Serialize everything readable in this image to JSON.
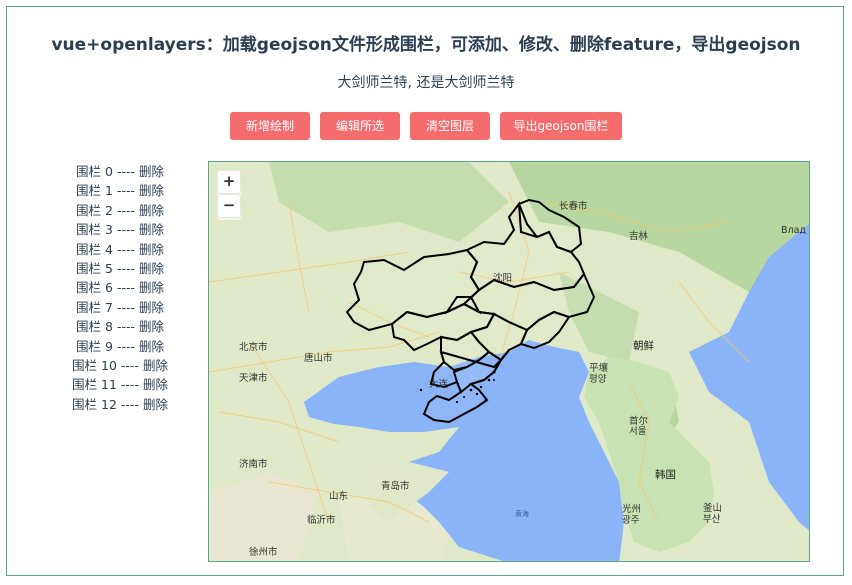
{
  "title": "vue+openlayers：加载geojson文件形成围栏，可添加、修改、删除feature，导出geojson",
  "subtitle": "大剑师兰特, 还是大剑师兰特",
  "buttons": {
    "add": "新增绘制",
    "edit": "编辑所选",
    "clear": "清空图层",
    "export": "导出geojson围栏"
  },
  "accent_color": "#f56c6c",
  "fences": [
    {
      "name": "围栏 0",
      "sep": "----",
      "action": "删除"
    },
    {
      "name": "围栏 1",
      "sep": "----",
      "action": "删除"
    },
    {
      "name": "围栏 2",
      "sep": "----",
      "action": "删除"
    },
    {
      "name": "围栏 3",
      "sep": "----",
      "action": "删除"
    },
    {
      "name": "围栏 4",
      "sep": "----",
      "action": "删除"
    },
    {
      "name": "围栏 5",
      "sep": "----",
      "action": "删除"
    },
    {
      "name": "围栏 6",
      "sep": "----",
      "action": "删除"
    },
    {
      "name": "围栏 7",
      "sep": "----",
      "action": "删除"
    },
    {
      "name": "围栏 8",
      "sep": "----",
      "action": "删除"
    },
    {
      "name": "围栏 9",
      "sep": "----",
      "action": "删除"
    },
    {
      "name": "围栏 10",
      "sep": "----",
      "action": "删除"
    },
    {
      "name": "围栏 11",
      "sep": "----",
      "action": "删除"
    },
    {
      "name": "围栏 12",
      "sep": "----",
      "action": "删除"
    }
  ],
  "map": {
    "zoom_in": "+",
    "zoom_out": "−",
    "labels": {
      "changchun": "长春市",
      "jilin": "吉林",
      "vladivostok": "Влад",
      "shenyang": "沈阳",
      "beijing": "北京市",
      "tangshan": "唐山市",
      "tianjin": "天津市",
      "dalian": "大连",
      "pyongyang_a": "平壤",
      "pyongyang_b": "평양",
      "north_korea": "朝鲜",
      "seoul_a": "首尔",
      "seoul_b": "서울",
      "south_korea": "韩国",
      "jinan": "济南市",
      "qingdao": "青岛市",
      "shandong": "山东",
      "linyi": "临沂市",
      "xuzhou": "徐州市",
      "gwangju_a": "光州",
      "gwangju_b": "광주",
      "busan_a": "釜山",
      "busan_b": "부산",
      "yellow_sea": "黄海"
    }
  }
}
